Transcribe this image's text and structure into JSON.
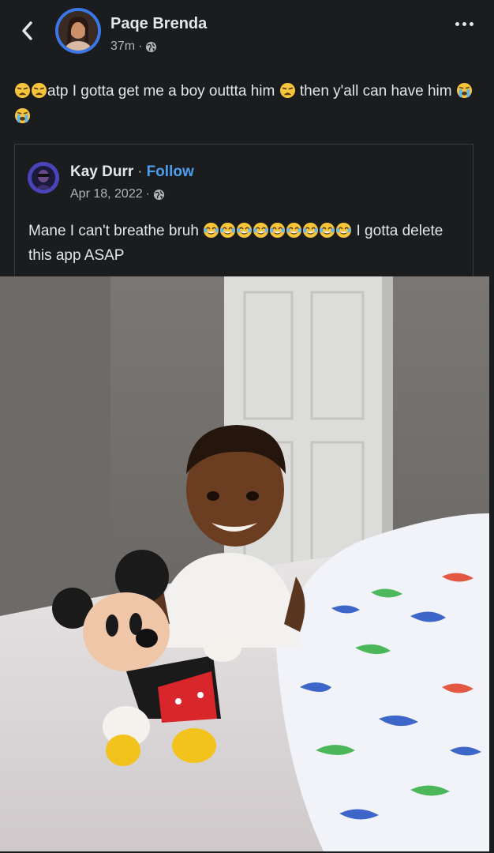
{
  "header": {
    "poster_name": "Paqe Brenda",
    "time": "37m",
    "separator": "·",
    "icons": {
      "back": "chevron-left-icon",
      "privacy": "globe-icon",
      "more": "more-dots-icon"
    }
  },
  "post": {
    "text_a": "atp I gotta get me a boy outtta him",
    "text_b": "then y'all can have him",
    "emojis": [
      "weary-face",
      "weary-face",
      "weary-face",
      "loudly-crying-face",
      "loudly-crying-face"
    ]
  },
  "shared": {
    "name": "Kay Durr",
    "separator": "·",
    "follow_label": "Follow",
    "date": "Apr 18, 2022",
    "text_a": "Mane I can't breathe bruh",
    "text_b": "I gotta delete this app ASAP",
    "emoji": "face-with-tears-of-joy",
    "emoji_count": 9
  },
  "photo": {
    "subject": "child-with-mickey-mouse-plush"
  },
  "colors": {
    "background": "#1b1c1e",
    "text": "#e4e6eb",
    "muted": "#b0b3b8",
    "link": "#4b9ef0",
    "avatar_ring": "#3b78e7"
  }
}
